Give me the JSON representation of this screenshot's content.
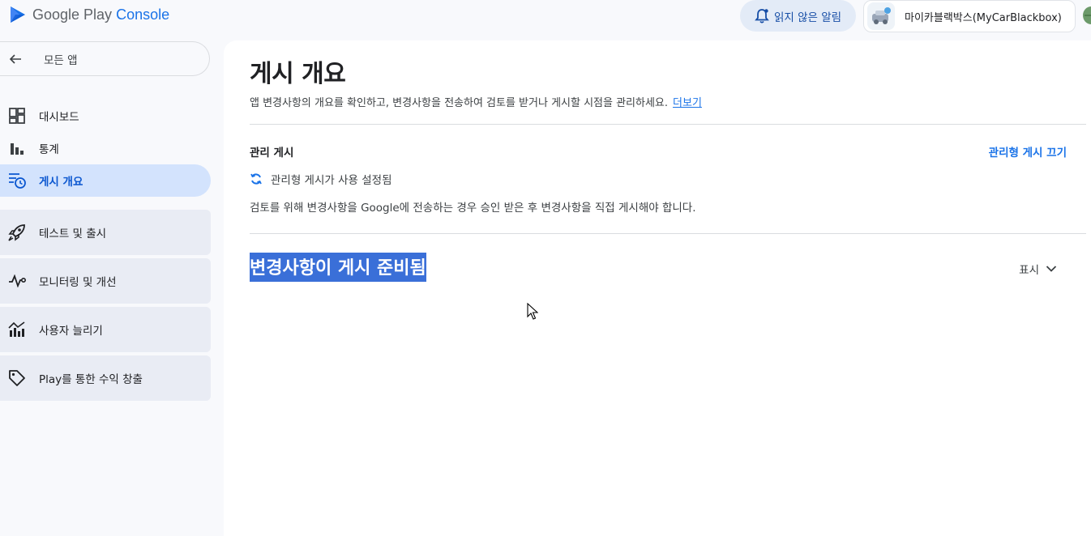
{
  "header": {
    "logo_text_main": "Google Play",
    "logo_text_accent": "Console",
    "notification_label": "읽지 않은 알림",
    "account_name": "마이카블랙박스(MyCarBlackbox)",
    "logo_icon": "play-console-logo",
    "notification_icon": "bell-icon"
  },
  "sidebar": {
    "back_label": "모든 앱",
    "items": [
      {
        "label": "대시보드",
        "icon": "dashboard-icon"
      },
      {
        "label": "통계",
        "icon": "bar-chart-icon"
      },
      {
        "label": "게시 개요",
        "icon": "publishing-overview-icon",
        "active": true
      }
    ],
    "groups": [
      {
        "label": "테스트 및 출시",
        "icon": "rocket-icon"
      },
      {
        "label": "모니터링 및 개선",
        "icon": "pulse-icon"
      },
      {
        "label": "사용자 늘리기",
        "icon": "growth-chart-icon"
      },
      {
        "label": "Play를 통한 수익 창출",
        "icon": "tag-icon"
      }
    ]
  },
  "main": {
    "title": "게시 개요",
    "description": "앱 변경사항의 개요를 확인하고, 변경사항을 전송하여 검토를 받거나 게시할 시점을 관리하세요.",
    "more_link": "더보기",
    "managed": {
      "title": "관리 게시",
      "toggle_link": "관리형 게시 끄기",
      "status": "관리형 게시가 사용 설정됨",
      "description": "검토를 위해 변경사항을 Google에 전송하는 경우 승인 받은 후 변경사항을 직접 게시해야 합니다."
    },
    "ready": {
      "title": "변경사항이 게시 준비됨",
      "show_label": "표시"
    }
  },
  "colors": {
    "accent": "#1a73e8",
    "active_nav_bg": "#d3e3fd",
    "selection_bg": "#3a6fd8"
  }
}
